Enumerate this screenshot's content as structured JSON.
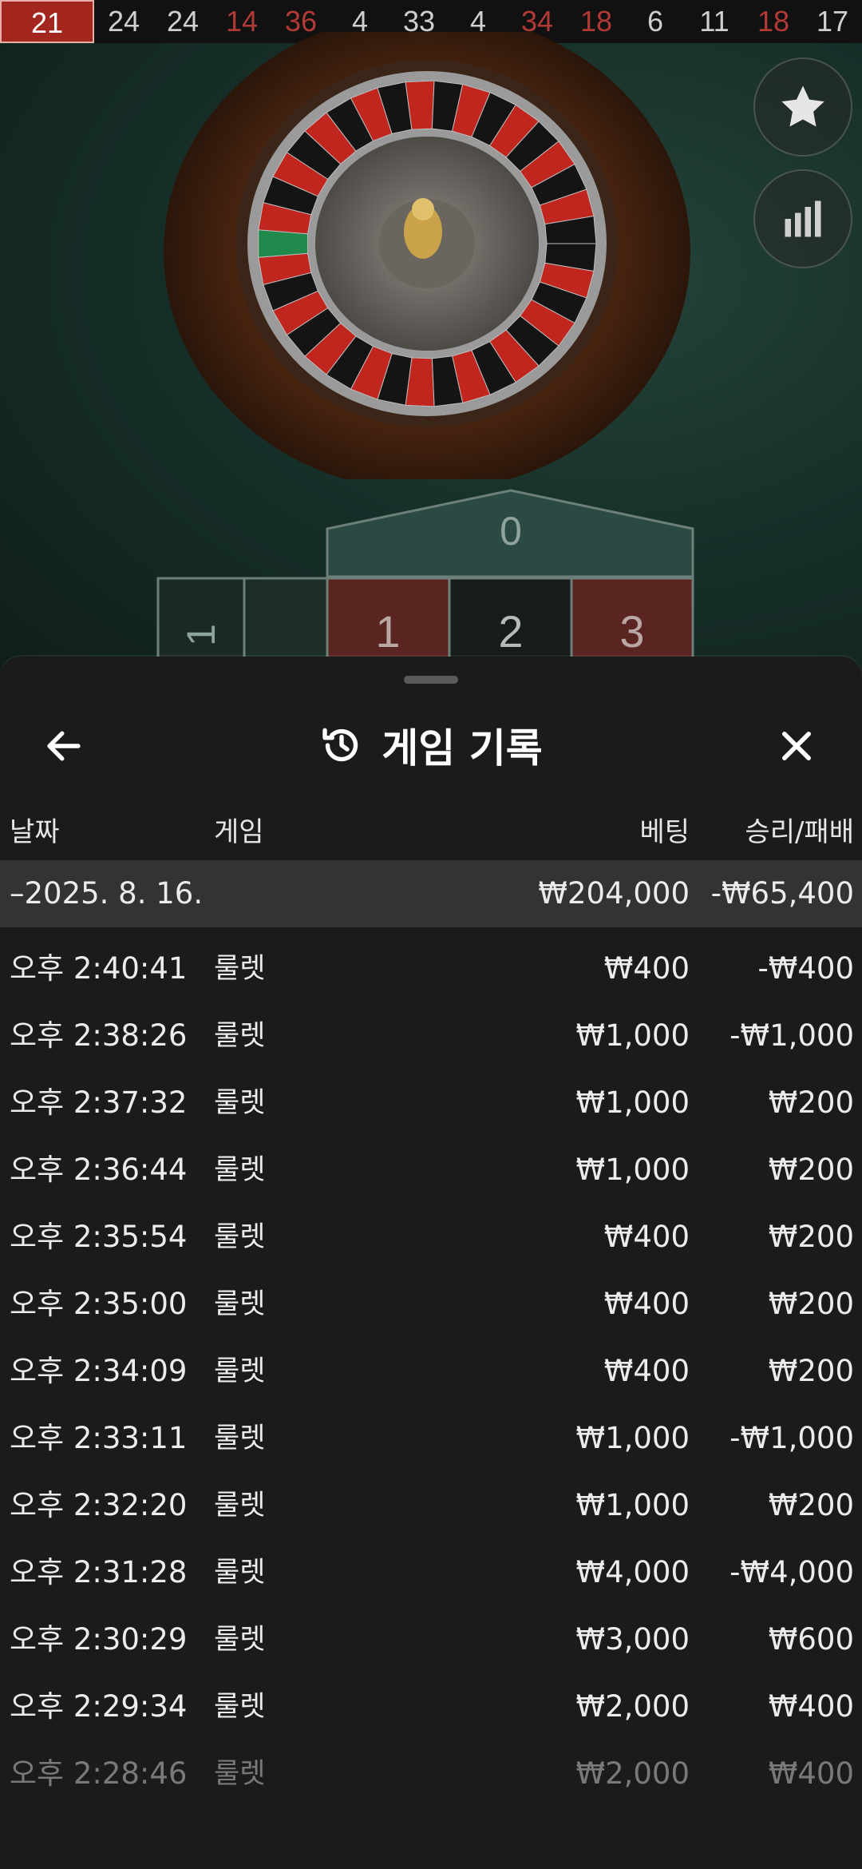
{
  "results_strip": [
    {
      "num": "21",
      "color": "red",
      "latest": true
    },
    {
      "num": "24",
      "color": "black"
    },
    {
      "num": "24",
      "color": "black"
    },
    {
      "num": "14",
      "color": "red"
    },
    {
      "num": "36",
      "color": "red"
    },
    {
      "num": "4",
      "color": "black"
    },
    {
      "num": "33",
      "color": "black"
    },
    {
      "num": "4",
      "color": "black"
    },
    {
      "num": "34",
      "color": "red"
    },
    {
      "num": "18",
      "color": "red"
    },
    {
      "num": "6",
      "color": "black"
    },
    {
      "num": "11",
      "color": "black"
    },
    {
      "num": "18",
      "color": "red"
    },
    {
      "num": "17",
      "color": "black"
    }
  ],
  "table_numbers": {
    "zero": "0",
    "cells": [
      "1",
      "2",
      "3"
    ],
    "left_partial": "1"
  },
  "side_buttons": {
    "favorite_icon": "star-icon",
    "stats_icon": "bar-chart-icon"
  },
  "sheet": {
    "title": "게임 기록",
    "title_icon": "history-icon",
    "back_icon": "arrow-left-icon",
    "close_icon": "close-icon",
    "columns": {
      "date": "날짜",
      "game": "게임",
      "bet": "베팅",
      "winloss": "승리/패배"
    },
    "day_summary": {
      "date": "–2025. 8. 16.",
      "bet": "₩204,000",
      "winloss": "-₩65,400"
    },
    "rows": [
      {
        "time": "오후 2:40:41",
        "game": "룰렛",
        "bet": "₩400",
        "winloss": "-₩400"
      },
      {
        "time": "오후 2:38:26",
        "game": "룰렛",
        "bet": "₩1,000",
        "winloss": "-₩1,000"
      },
      {
        "time": "오후 2:37:32",
        "game": "룰렛",
        "bet": "₩1,000",
        "winloss": "₩200"
      },
      {
        "time": "오후 2:36:44",
        "game": "룰렛",
        "bet": "₩1,000",
        "winloss": "₩200"
      },
      {
        "time": "오후 2:35:54",
        "game": "룰렛",
        "bet": "₩400",
        "winloss": "₩200"
      },
      {
        "time": "오후 2:35:00",
        "game": "룰렛",
        "bet": "₩400",
        "winloss": "₩200"
      },
      {
        "time": "오후 2:34:09",
        "game": "룰렛",
        "bet": "₩400",
        "winloss": "₩200"
      },
      {
        "time": "오후 2:33:11",
        "game": "룰렛",
        "bet": "₩1,000",
        "winloss": "-₩1,000"
      },
      {
        "time": "오후 2:32:20",
        "game": "룰렛",
        "bet": "₩1,000",
        "winloss": "₩200"
      },
      {
        "time": "오후 2:31:28",
        "game": "룰렛",
        "bet": "₩4,000",
        "winloss": "-₩4,000"
      },
      {
        "time": "오후 2:30:29",
        "game": "룰렛",
        "bet": "₩3,000",
        "winloss": "₩600"
      },
      {
        "time": "오후 2:29:34",
        "game": "룰렛",
        "bet": "₩2,000",
        "winloss": "₩400"
      },
      {
        "time": "오후 2:28:46",
        "game": "룰렛",
        "bet": "₩2,000",
        "winloss": "₩400"
      }
    ]
  },
  "colors": {
    "red": "#a3261f",
    "felt": "#1e3a32",
    "sheet_bg": "#1b1b1b",
    "day_row_bg": "#333333"
  }
}
